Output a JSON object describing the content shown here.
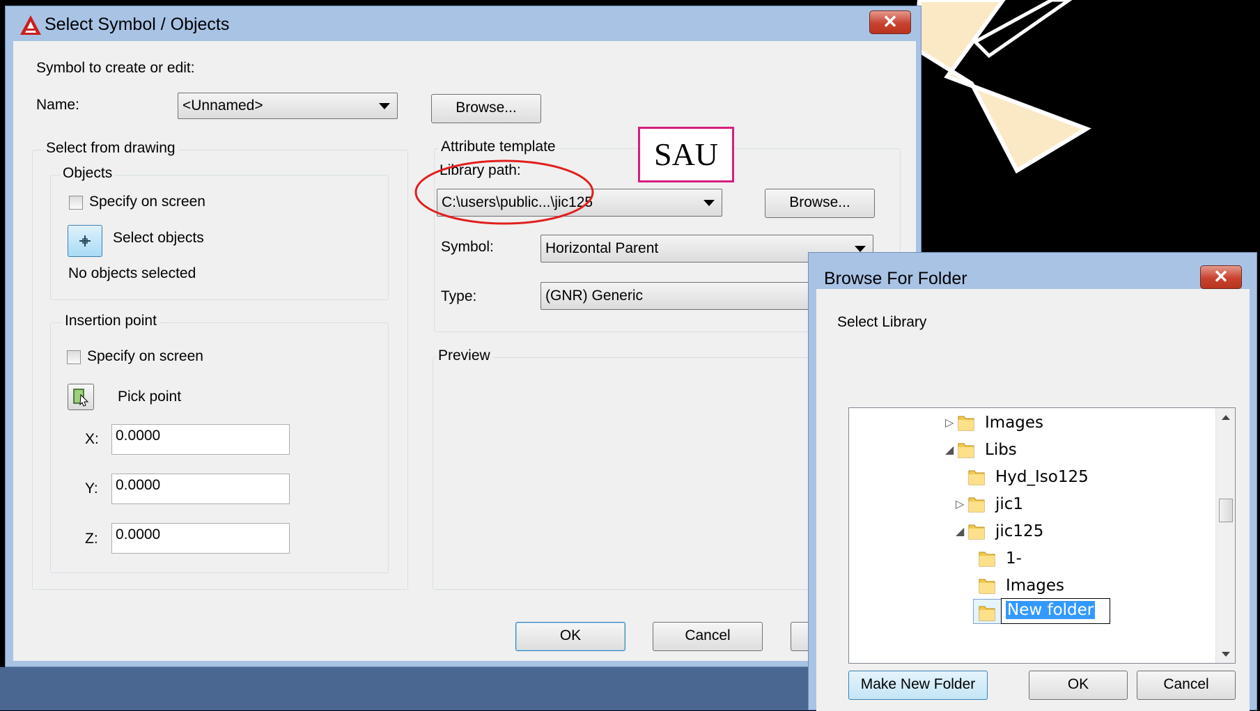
{
  "main_dialog": {
    "title": "Select Symbol / Objects",
    "close_label": "✕",
    "symbol_prompt": "Symbol to create or edit:",
    "name_label": "Name:",
    "name_value": "<Unnamed>",
    "browse_label": "Browse...",
    "select_from_drawing": {
      "title": "Select from drawing",
      "objects_title": "Objects",
      "specify_on_screen": "Specify on screen",
      "select_objects": "Select objects",
      "status": "No objects selected",
      "insertion_title": "Insertion point",
      "insertion_specify": "Specify on screen",
      "pick_point": "Pick point",
      "x_label": "X:",
      "x_value": "0.0000",
      "y_label": "Y:",
      "y_value": "0.0000",
      "z_label": "Z:",
      "z_value": "0.0000"
    },
    "attribute_template": {
      "title": "Attribute template",
      "library_path_label": "Library path:",
      "library_path_value": "C:\\users\\public...\\jic125",
      "browse_label": "Browse...",
      "symbol_label": "Symbol:",
      "symbol_value": "Horizontal Parent",
      "type_label": "Type:",
      "type_value": "(GNR) Generic"
    },
    "preview_title": "Preview",
    "ok_label": "OK",
    "cancel_label": "Cancel"
  },
  "annotation": {
    "sau_label": "SAU"
  },
  "folder_dialog": {
    "title": "Browse For Folder",
    "close_label": "✕",
    "prompt": "Select Library",
    "tree": [
      {
        "label": "Images",
        "expander": "▷"
      },
      {
        "label": "Libs",
        "expander": "◢"
      },
      {
        "label": "Hyd_Iso125",
        "expander": ""
      },
      {
        "label": "jic1",
        "expander": "▷"
      },
      {
        "label": "jic125",
        "expander": "◢"
      },
      {
        "label": "1-",
        "expander": ""
      },
      {
        "label": "Images",
        "expander": ""
      },
      {
        "label": "New folder",
        "expander": ""
      }
    ],
    "make_new_folder_label": "Make New Folder",
    "ok_label": "OK",
    "cancel_label": "Cancel"
  },
  "colors": {
    "title_bar": "#a9c3e5",
    "dialog_bg": "#f0f0f0",
    "annotation_magenta": "#d61e7f",
    "annotation_red": "#e0201f",
    "selection": "#3399ff",
    "desktop_band": "#4a6791"
  }
}
